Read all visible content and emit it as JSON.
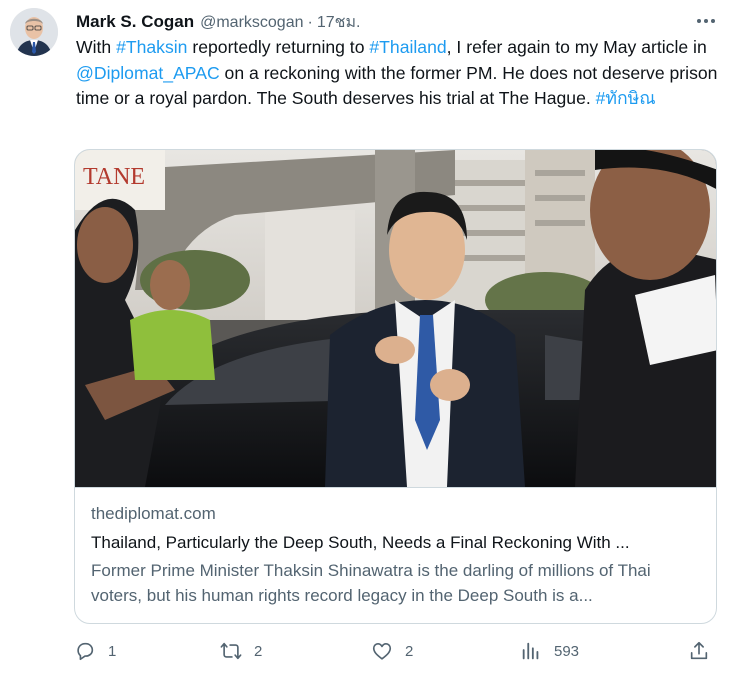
{
  "author": {
    "name": "Mark S. Cogan",
    "handle": "@markscogan",
    "separator": "·",
    "time": "17ชม."
  },
  "tweet": {
    "segments": [
      {
        "text": "With ",
        "link": false
      },
      {
        "text": "#Thaksin",
        "link": true
      },
      {
        "text": " reportedly returning to ",
        "link": false
      },
      {
        "text": "#Thailand",
        "link": true
      },
      {
        "text": ", I refer again to my May article in ",
        "link": false
      },
      {
        "text": "@Diplomat_APAC",
        "link": true
      },
      {
        "text": " on a reckoning with the former PM. He does not deserve prison time or a royal pardon. The South deserves his trial at The Hague. ",
        "link": false
      },
      {
        "text": "#ทักษิณ",
        "link": true
      }
    ]
  },
  "card": {
    "image_sign_text": "TANE",
    "domain": "thediplomat.com",
    "title": "Thailand, Particularly the Deep South, Needs a Final Reckoning With ...",
    "description": "Former Prime Minister Thaksin Shinawatra is the darling of millions of Thai voters, but his human rights record legacy in the Deep South is a..."
  },
  "actions": {
    "reply_count": "1",
    "retweet_count": "2",
    "like_count": "2",
    "views_count": "593"
  },
  "colors": {
    "link": "#1d9bf0",
    "secondary_text": "#536471",
    "border": "#cfd9de"
  },
  "icons": [
    "more-icon",
    "reply-icon",
    "retweet-icon",
    "like-icon",
    "views-icon",
    "share-icon"
  ]
}
